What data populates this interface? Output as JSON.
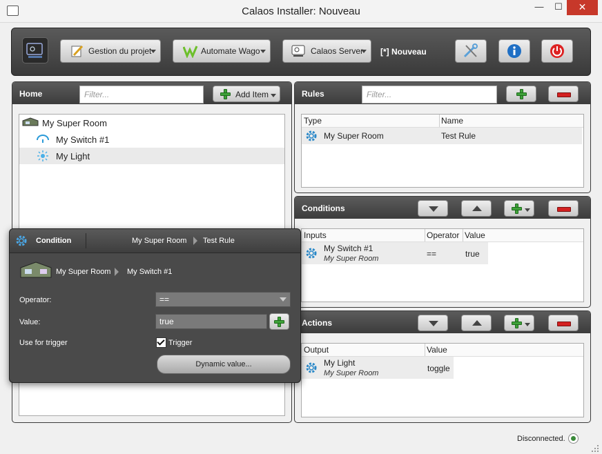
{
  "window": {
    "title": "Calaos Installer:  Nouveau",
    "controls": {
      "minimize": "—",
      "maximize": "☐",
      "close": "✕"
    }
  },
  "toolbar": {
    "project_label": "Gestion du projet",
    "wago_label": "Automate Wago",
    "server_label": "Calaos Server",
    "project_name": "[*] Nouveau",
    "icons": [
      "calaos-logo-icon",
      "wrench-icon",
      "info-icon",
      "power-icon"
    ]
  },
  "home": {
    "title": "Home",
    "filter_placeholder": "Filter...",
    "add_item_label": "Add Item",
    "tree": [
      {
        "label": "My Super Room",
        "icon": "room-icon"
      },
      {
        "label": "My Switch #1",
        "icon": "switch-icon"
      },
      {
        "label": "My Light",
        "icon": "light-icon"
      }
    ]
  },
  "rules": {
    "title": "Rules",
    "filter_placeholder": "Filter...",
    "columns": [
      "Type",
      "Name"
    ],
    "rows": [
      {
        "type": "My Super Room",
        "name": "Test Rule"
      }
    ]
  },
  "conditions": {
    "title": "Conditions",
    "columns": [
      "Inputs",
      "Operator",
      "Value"
    ],
    "rows": [
      {
        "input": "My Switch #1",
        "room": "My Super Room",
        "operator": "==",
        "value": "true"
      }
    ]
  },
  "actions": {
    "title": "Actions",
    "columns": [
      "Output",
      "Value"
    ],
    "rows": [
      {
        "output": "My Light",
        "room": "My Super Room",
        "value": "toggle"
      }
    ]
  },
  "condition_popup": {
    "title": "Condition",
    "breadcrumb": [
      "My Super Room",
      "Test Rule"
    ],
    "item_path": [
      "My Super Room",
      "My Switch #1"
    ],
    "operator_label": "Operator:",
    "operator_value": "==",
    "value_label": "Value:",
    "value_value": "true",
    "trigger_label": "Use for trigger",
    "trigger_checkbox_label": "Trigger",
    "trigger_checked": true,
    "dynamic_button": "Dynamic value..."
  },
  "status": {
    "text": "Disconnected."
  },
  "colors": {
    "accent_green": "#3fa23a",
    "accent_red": "#d32020",
    "close_red": "#c7382a",
    "header_dark": "#4a4a4a"
  }
}
